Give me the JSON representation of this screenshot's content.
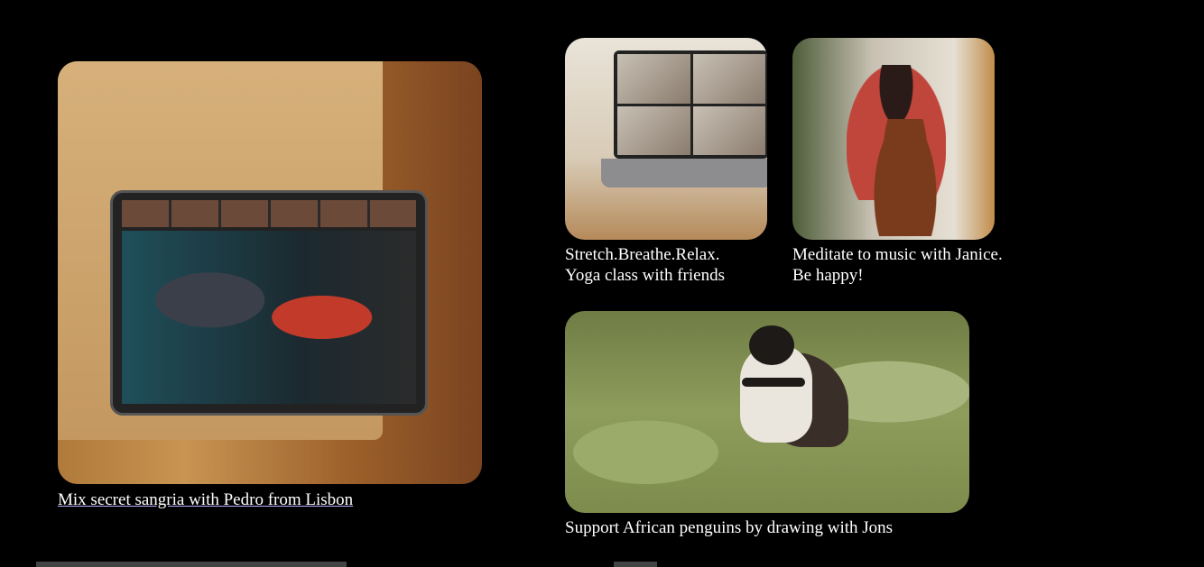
{
  "cards": [
    {
      "caption": "Mix secret sangria with Pedro from Lisbon",
      "linked": true
    },
    {
      "caption_line1": "Stretch.Breathe.Relax.",
      "caption_line2": "Yoga class with friends"
    },
    {
      "caption_line1": "Meditate to music with Janice.",
      "caption_line2": "Be happy!"
    },
    {
      "caption": "Support African penguins by drawing with Jons"
    }
  ]
}
